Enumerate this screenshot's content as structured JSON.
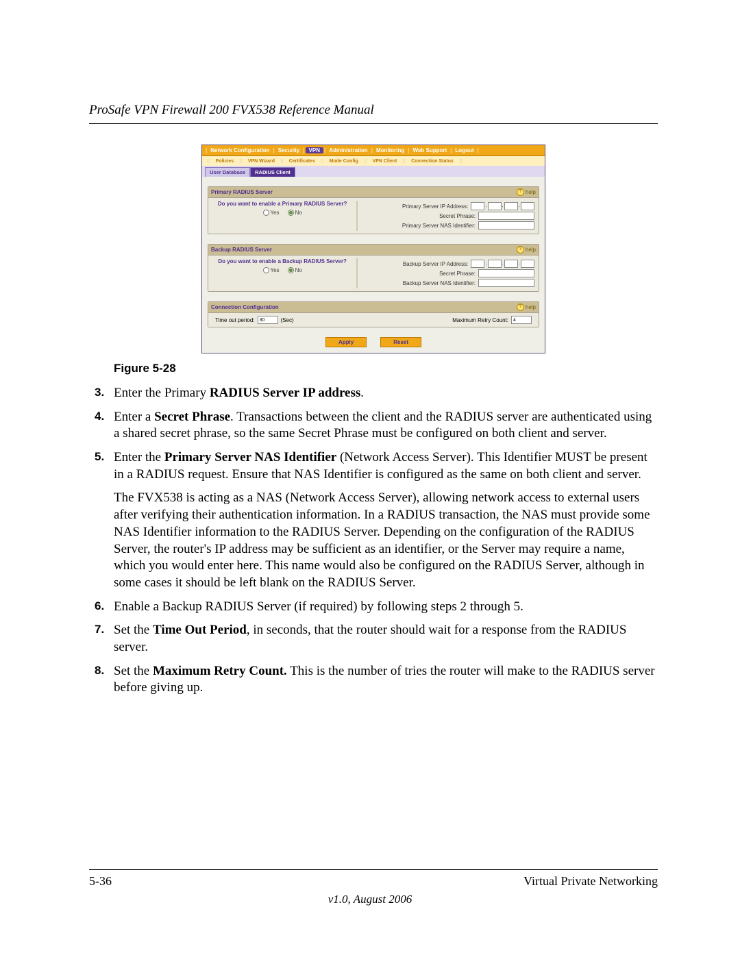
{
  "header": {
    "title": "ProSafe VPN Firewall 200 FVX538 Reference Manual"
  },
  "figure": {
    "caption": "Figure 5-28"
  },
  "router": {
    "topTabs": {
      "items": [
        "Network Configuration",
        "Security",
        "VPN",
        "Administration",
        "Monitoring",
        "Web Support",
        "Logout"
      ],
      "activeIndex": 2
    },
    "subTabs": {
      "items": [
        "Policies",
        "VPN Wizard",
        "Certificates",
        "Mode Config",
        "VPN Client",
        "Connection Status"
      ]
    },
    "secTabs": {
      "items": [
        "User Database",
        "RADIUS Client"
      ],
      "activeIndex": 1
    },
    "help": "help",
    "primary": {
      "title": "Primary RADIUS Server",
      "question": "Do you want to enable a Primary RADIUS Server?",
      "yes": "Yes",
      "no": "No",
      "selected": "no",
      "ip_label": "Primary Server IP Address:",
      "secret_label": "Secret Phrase:",
      "nas_label": "Primary Server NAS Identifier:"
    },
    "backup": {
      "title": "Backup RADIUS Server",
      "question": "Do you want to enable a Backup RADIUS Server?",
      "yes": "Yes",
      "no": "No",
      "selected": "no",
      "ip_label": "Backup Server IP Address:",
      "secret_label": "Secret Phrase:",
      "nas_label": "Backup Server NAS Identifier:"
    },
    "conn": {
      "title": "Connection Configuration",
      "timeout_label": "Time out period:",
      "timeout_value": "30",
      "timeout_unit": "(Sec)",
      "retry_label": "Maximum Retry Count:",
      "retry_value": "4"
    },
    "buttons": {
      "apply": "Apply",
      "reset": "Reset"
    }
  },
  "steps": {
    "s3_num": "3.",
    "s3_a": "Enter the Primary ",
    "s3_b": "RADIUS Server IP address",
    "s3_c": ".",
    "s4_num": "4.",
    "s4_a": "Enter a ",
    "s4_b": "Secret Phrase",
    "s4_c": ". Transactions between the client and the RADIUS server are authenticated using a shared secret phrase, so the same Secret Phrase must be configured on both client and server.",
    "s5_num": "5.",
    "s5_a": "Enter the ",
    "s5_b": "Primary Server NAS Identifier",
    "s5_c": " (Network Access Server). This Identifier MUST be present in a RADIUS request. Ensure that NAS Identifier is configured as the same on both client and server.",
    "s5_para": "The FVX538 is acting as a NAS (Network Access Server), allowing network access to external users after verifying their authentication information. In a RADIUS transaction, the NAS must provide some NAS Identifier information to the RADIUS Server. Depending on the configuration of the RADIUS Server, the router's IP address may be sufficient as an identifier, or the Server may require a name, which you would enter here. This name would also be configured on the RADIUS Server, although in some cases it should be left blank on the RADIUS Server.",
    "s6_num": "6.",
    "s6": "Enable a Backup RADIUS Server (if required) by following steps 2 through 5.",
    "s7_num": "7.",
    "s7_a": "Set the ",
    "s7_b": "Time Out Period",
    "s7_c": ", in seconds, that the router should wait for a response from the RADIUS server.",
    "s8_num": "8.",
    "s8_a": "Set the ",
    "s8_b": "Maximum Retry Count.",
    "s8_c": " This is the number of tries the router will make to the RADIUS server before giving up."
  },
  "footer": {
    "page": "5-36",
    "section": "Virtual Private Networking",
    "version": "v1.0, August 2006"
  }
}
